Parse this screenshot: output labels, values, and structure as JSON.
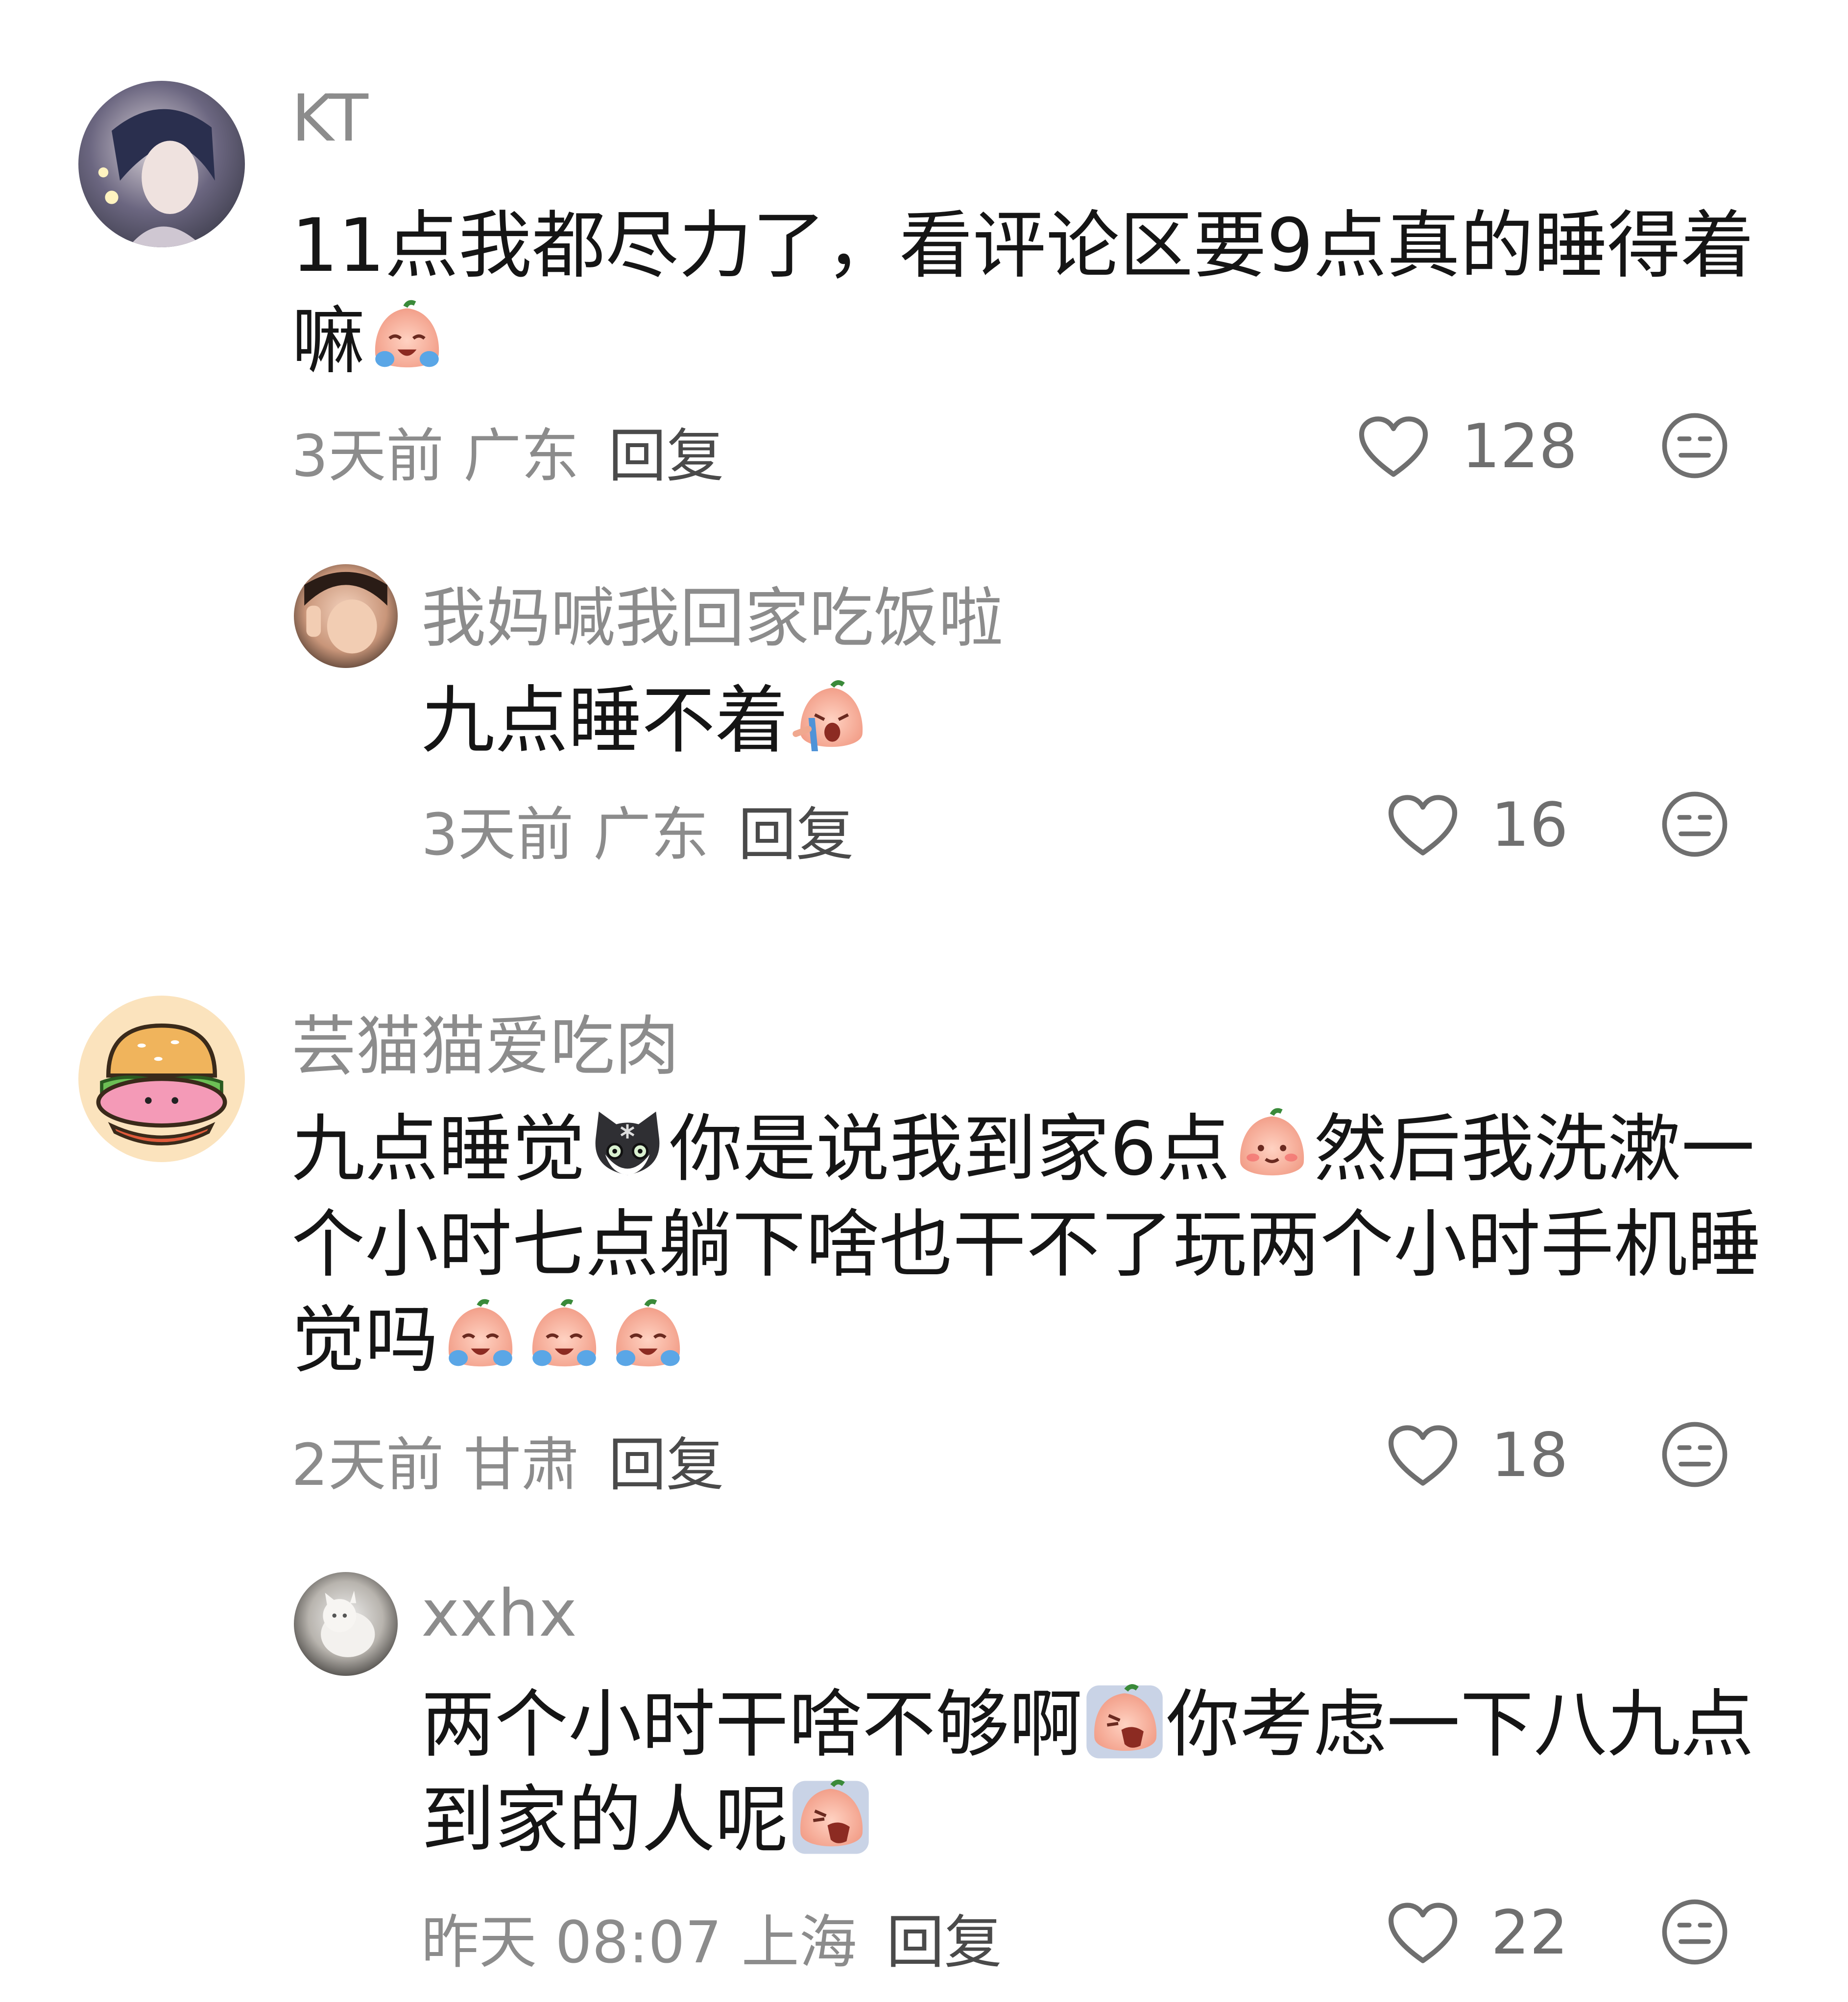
{
  "comments": [
    {
      "username": "KT",
      "text_1": "11点我都尽力了，看评论区要9点真的睡得着嘛",
      "emoji_1": "crying-peach-emoji",
      "time": "3天前",
      "location": "广东",
      "reply": "回复",
      "likes": "128"
    },
    {
      "username": "我妈喊我回家吃饭啦",
      "text_1": "九点睡不着",
      "emoji_1": "sobbing-peach-emoji",
      "time": "3天前",
      "location": "广东",
      "reply": "回复",
      "likes": "16"
    },
    {
      "username": "芸猫猫爱吃肉",
      "text_1": "九点睡觉",
      "emoji_1": "shocked-cat-emoji",
      "text_2": "你是说我到家6点",
      "emoji_2": "blushing-peach-emoji",
      "text_3": "然后我洗漱一个小时七点躺下啥也干不了玩两个小时手机睡觉吗",
      "emoji_3": "crying-peach-emoji",
      "time": "2天前",
      "location": "甘肃",
      "reply": "回复",
      "likes": "18"
    },
    {
      "username": "xxhx",
      "text_1": "两个小时干啥不够啊",
      "emoji_1": "wailing-peach-emoji",
      "text_2": "你考虑一下八九点到家的人呢",
      "emoji_2": "wailing-peach-emoji",
      "time": "昨天 08:07",
      "location": "上海",
      "reply": "回复",
      "likes": "22"
    }
  ],
  "icons": {
    "like": "heart-outline-icon",
    "dislike": "unamused-face-icon"
  },
  "colors": {
    "username": "#8c8c8c",
    "text": "#151515",
    "meta": "#8c8c8c",
    "reply": "#4a4a4a",
    "icon": "#6f6f6f"
  }
}
